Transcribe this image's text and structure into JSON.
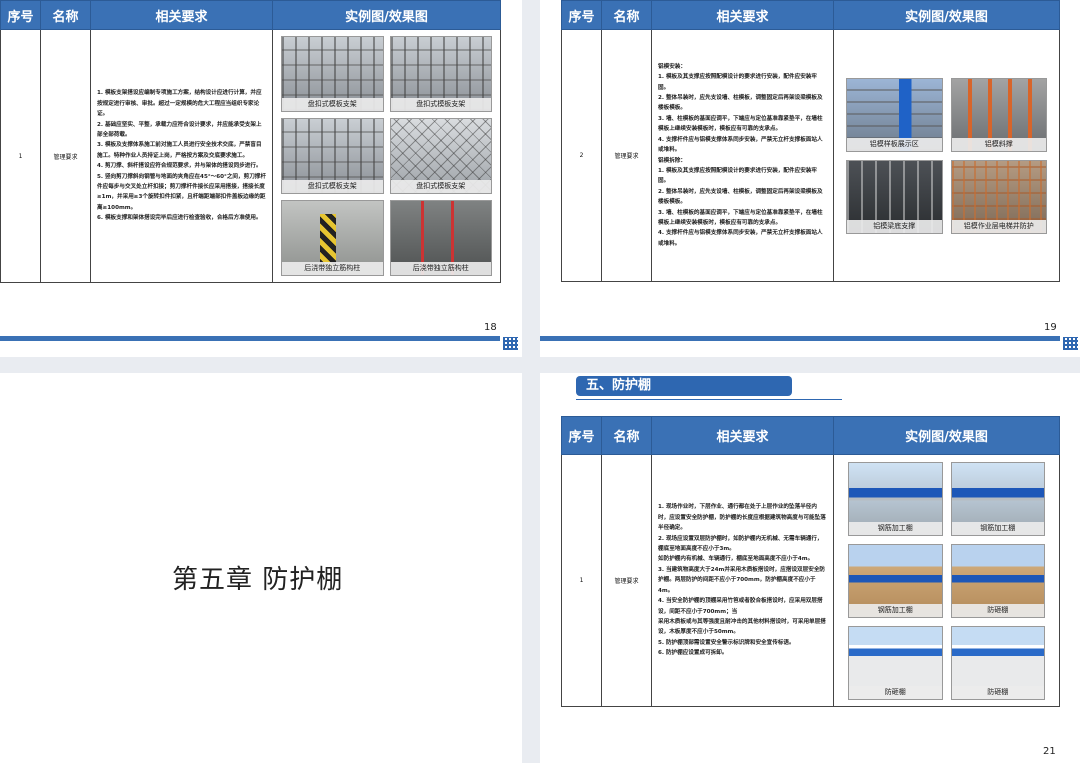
{
  "headers": {
    "num": "序号",
    "name": "名称",
    "req": "相关要求",
    "img": "实例图/效果图"
  },
  "page18": {
    "row_num": "1",
    "row_name": "管理要求",
    "requirements": [
      "1. 模板支架搭设应编制专项施工方案，结构设计应进行计算，并应按规定进行审核、审批。超过一定规模的危大工程应当组织专家论证。",
      "2. 基础应坚实、平整，承载力应符合设计要求，并应能承受支架上部全部荷载。",
      "3. 模板及支撑体系施工前对施工人员进行安全技术交底，严禁盲目施工。特种作业人员持证上岗，严格按方案及交底要求施工。",
      "4. 剪刀撑、斜杆搭设应符合规范要求，并与架体的搭设同步进行。",
      "5. 竖向剪刀撑斜向钢管与地面的夹角应在45°～60°之间，剪刀撑杆件应每步与交叉处立杆扣接；剪刀撑杆件接长应采用搭接，搭接长度≥1m，并采用≥3个旋转扣件扣紧，且杆端距端部扣件盖板边缘的距离≥100mm。",
      "6. 模板支撑和架体搭设完毕后应进行检查验收，合格后方准使用。"
    ],
    "images": [
      "盘扣式模板支架",
      "盘扣式模板支架",
      "盘扣式模板支架",
      "盘扣式模板支架",
      "后浇带独立筋构柱",
      "后浇带独立筋构柱"
    ],
    "page_number": "18"
  },
  "page19": {
    "row_num": "2",
    "row_name": "管理要求",
    "requirements": [
      "铝模安装：",
      "1. 模板及其支撑应按照配模设计的要求进行安装，配件应安装牢固。",
      "2. 整体吊装时，应先支设墙、柱模板，调整固定后再架设梁模板及楼板模板。",
      "3. 墙、柱模板的基面应调平，下端应与定位基准靠紧垫平，在墙柱模板上继续安装模板时，模板应有可靠的支承点。",
      "4. 支撑杆件应与铝模支撑体系同步安装，严禁无立杆支撑板面站人或堆料。",
      "铝模拆除：",
      "1. 模板及其支撑应按照配模设计的要求进行安装，配件应安装牢固。",
      "2. 整体吊装时，应先支设墙、柱模板，调整固定后再架设梁模板及楼板模板。",
      "3. 墙、柱模板的基面应调平，下端应与定位基准靠紧垫平，在墙柱模板上继续安装模板时，模板应有可靠的支承点。",
      "4. 支撑杆件应与铝模支撑体系同步安装，严禁无立杆支撑板面站人或堆料。"
    ],
    "images": [
      "铝模样板展示区",
      "铝模斜撑",
      "铝模梁底支撑",
      "铝模作业层电梯井防护"
    ],
    "page_number": "19"
  },
  "page20": {
    "chapter_title": "第五章 防护棚"
  },
  "page21": {
    "section_title": "五、防护棚",
    "row_num": "1",
    "row_name": "管理要求",
    "requirements": [
      "1. 现场作业时，下层作业、通行都在处于上层作业的坠落半径内时，应设置安全防护棚，防护棚的长度应根据建筑物高度与可能坠落半径确定。",
      "2. 现场应设置双层防护棚时，如防护棚内无机械、无需车辆通行，棚底至地面高度不应小于3m。",
      "如防护棚内有机械、车辆通行，棚底至地面高度不应小于4m。",
      "3. 当建筑物高度大于24m并采用木质板搭设时，应搭设双层安全防护棚。两层防护的间距不应小于700mm，防护棚高度不应小于4m。",
      "4. 当安全防护棚的顶棚采用竹笆或者胶合板搭设时，应采用双层搭设，间距不应小于700mm；当",
      "采用木质板或与其等强度且耐冲击的其他材料搭设时，可采用单层搭设，木板厚度不应小于50mm。",
      "5. 防护棚顶部需设置安全警示标识牌和安全宣传标语。",
      "6. 防护棚应设置成可拆卸。"
    ],
    "images": [
      "钢筋加工棚",
      "钢筋加工棚",
      "钢筋加工棚",
      "防砸棚",
      "防砸棚",
      "防砸棚"
    ],
    "page_number": "21"
  }
}
